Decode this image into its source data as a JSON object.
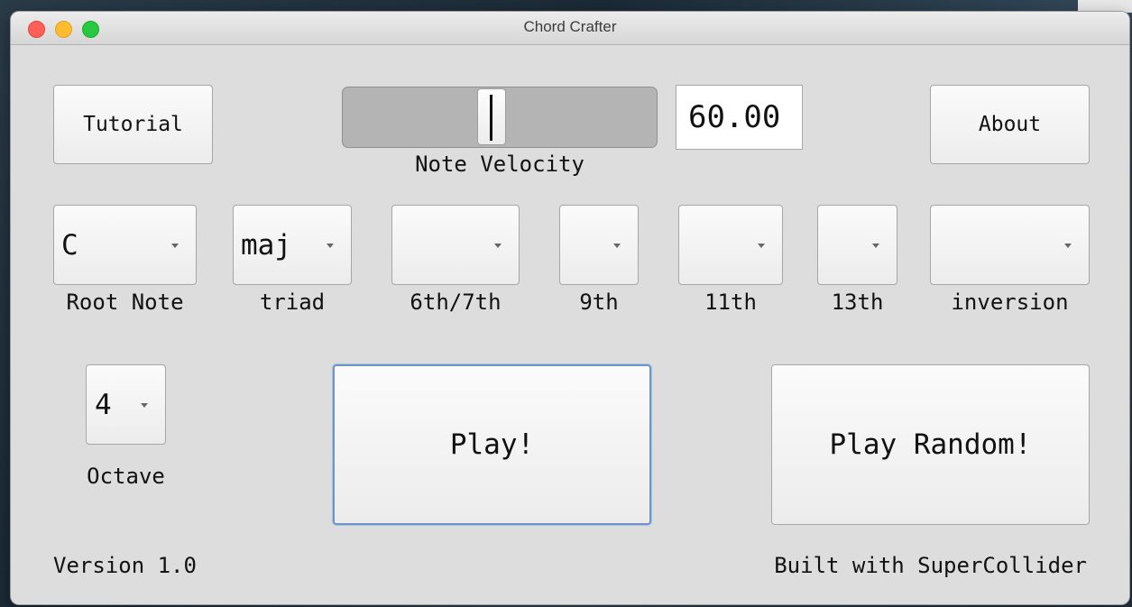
{
  "window": {
    "title": "Chord Crafter"
  },
  "buttons": {
    "tutorial": "Tutorial",
    "about": "About",
    "play": "Play!",
    "play_random": "Play Random!"
  },
  "velocity": {
    "label": "Note Velocity",
    "value": "60.00",
    "slider_fraction": 0.47
  },
  "dropdowns": {
    "root_note": {
      "value": "C",
      "label": "Root Note"
    },
    "triad": {
      "value": "maj",
      "label": "triad"
    },
    "sixth_seventh": {
      "value": "",
      "label": "6th/7th"
    },
    "ninth": {
      "value": "",
      "label": "9th"
    },
    "eleventh": {
      "value": "",
      "label": "11th"
    },
    "thirteenth": {
      "value": "",
      "label": "13th"
    },
    "inversion": {
      "value": "",
      "label": "inversion"
    },
    "octave": {
      "value": "4",
      "label": "Octave"
    }
  },
  "footer": {
    "version": "Version 1.0",
    "credit": "Built with SuperCollider"
  }
}
